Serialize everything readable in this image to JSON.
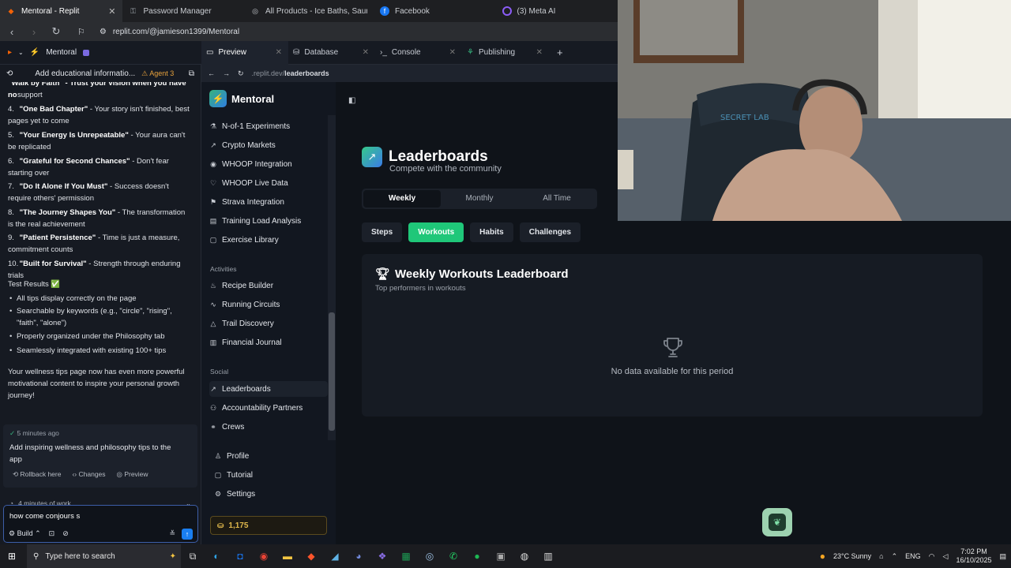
{
  "browser": {
    "tabs": [
      {
        "label": "Mentoral - Replit",
        "icon": "replit-icon",
        "active": true
      },
      {
        "label": "Password Manager",
        "icon": "key-icon",
        "active": false
      },
      {
        "label": "All Products - Ice Baths, Saunas & Re",
        "icon": "globe-icon",
        "active": false
      },
      {
        "label": "Facebook",
        "icon": "facebook-icon",
        "active": false
      },
      {
        "label": "(3) Meta AI",
        "icon": "meta-icon",
        "active": false
      }
    ],
    "url": "replit.com/@jamieson1399/Mentoral"
  },
  "replit": {
    "project_name": "Mentoral",
    "tabs": [
      {
        "label": "Preview",
        "active": true
      },
      {
        "label": "Database",
        "active": false
      },
      {
        "label": "Console",
        "active": false
      },
      {
        "label": "Publishing",
        "active": false
      }
    ],
    "preview_path_prefix": ".replit.dev/",
    "preview_path": "leaderboards"
  },
  "agent": {
    "task_title": "Add educational informatio...",
    "agent_badge": "Agent 3",
    "partial_top": "\"Walk by Faith\" - Trust your vision when you have no",
    "partial_top_2": "support",
    "list": [
      {
        "num": "4.",
        "title": "\"One Bad Chapter\"",
        "desc": " - Your story isn't finished, best pages yet to come"
      },
      {
        "num": "5.",
        "title": "\"Your Energy Is Unrepeatable\"",
        "desc": " - Your aura can't be replicated"
      },
      {
        "num": "6.",
        "title": "\"Grateful for Second Chances\"",
        "desc": " - Don't fear starting over"
      },
      {
        "num": "7.",
        "title": "\"Do It Alone If You Must\"",
        "desc": " - Success doesn't require others' permission"
      },
      {
        "num": "8.",
        "title": "\"The Journey Shapes You\"",
        "desc": " - The transformation is the real achievement"
      },
      {
        "num": "9.",
        "title": "\"Patient Persistence\"",
        "desc": " - Time is just a measure, commitment counts"
      },
      {
        "num": "10.",
        "title": "\"Built for Survival\"",
        "desc": " - Strength through enduring trials"
      }
    ],
    "test_results_label": "Test Results ✅",
    "bullets": [
      "All tips display correctly on the page",
      "Searchable by keywords (e.g., \"circle\", \"rising\", \"faith\", \"alone\")",
      "Properly organized under the Philosophy tab",
      "Seamlessly integrated with existing 100+ tips"
    ],
    "summary": "Your wellness tips page now has even more powerful motivational content to inspire your personal growth journey!",
    "checkpoint": {
      "time": "5 minutes ago",
      "message": "Add inspiring wellness and philosophy tips to the app",
      "actions": [
        "Rollback here",
        "Changes",
        "Preview"
      ]
    },
    "work_label": "4 minutes of work",
    "input_value": "how come conjours s",
    "build_label": "Build"
  },
  "app": {
    "brand": "Mentoral",
    "nav_top": [
      {
        "label": "N-of-1 Experiments",
        "icon": "flask-icon"
      },
      {
        "label": "Crypto Markets",
        "icon": "trend-icon"
      },
      {
        "label": "WHOOP Integration",
        "icon": "whoop-icon"
      },
      {
        "label": "WHOOP Live Data",
        "icon": "pulse-icon"
      },
      {
        "label": "Strava Integration",
        "icon": "run-icon"
      },
      {
        "label": "Training Load Analysis",
        "icon": "chart-icon"
      },
      {
        "label": "Exercise Library",
        "icon": "book-icon"
      }
    ],
    "section_activities": "Activities",
    "nav_activities": [
      {
        "label": "Recipe Builder",
        "icon": "chef-icon"
      },
      {
        "label": "Running Circuits",
        "icon": "activity-icon"
      },
      {
        "label": "Trail Discovery",
        "icon": "mountain-icon"
      },
      {
        "label": "Financial Journal",
        "icon": "journal-icon"
      }
    ],
    "section_social": "Social",
    "nav_social": [
      {
        "label": "Leaderboards",
        "icon": "trend-icon",
        "active": true
      },
      {
        "label": "Accountability Partners",
        "icon": "users-icon"
      },
      {
        "label": "Crews",
        "icon": "link-icon"
      }
    ],
    "nav_bottom": [
      {
        "label": "Profile",
        "icon": "user-icon"
      },
      {
        "label": "Tutorial",
        "icon": "book-icon"
      },
      {
        "label": "Settings",
        "icon": "gear-icon"
      }
    ],
    "points": "1,175",
    "page_title": "Leaderboards",
    "page_subtitle": "Compete with the community",
    "period_tabs": [
      {
        "label": "Weekly",
        "active": true
      },
      {
        "label": "Monthly",
        "active": false
      },
      {
        "label": "All Time",
        "active": false
      }
    ],
    "category_tabs": [
      {
        "label": "Steps",
        "active": false
      },
      {
        "label": "Workouts",
        "active": true
      },
      {
        "label": "Habits",
        "active": false
      },
      {
        "label": "Challenges",
        "active": false
      }
    ],
    "card_title": "Weekly Workouts Leaderboard",
    "card_subtitle": "Top performers in workouts",
    "empty_text": "No data available for this period"
  },
  "taskbar": {
    "search_placeholder": "Type here to search",
    "weather": "23°C  Sunny",
    "lang": "ENG",
    "time": "7:02 PM",
    "date": "16/10/2025"
  },
  "colors": {
    "accent_green": "#1fc779",
    "accent_blue": "#1a7ef0",
    "points_gold": "#e0b84c"
  }
}
